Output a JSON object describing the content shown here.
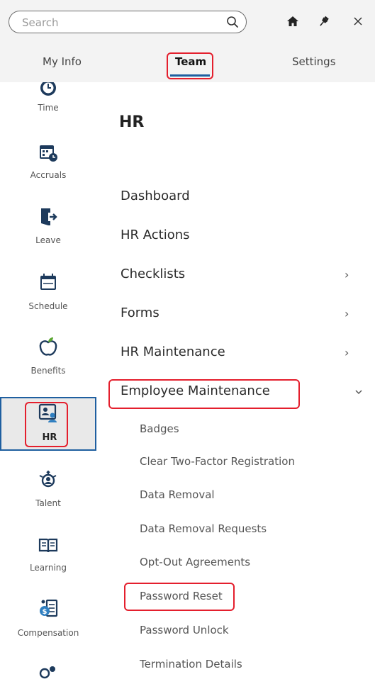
{
  "search": {
    "placeholder": "Search"
  },
  "header_icons": [
    "search-icon",
    "home-icon",
    "pin-icon",
    "close-icon"
  ],
  "tabs": [
    {
      "label": "My Info"
    },
    {
      "label": "Team",
      "active": true
    },
    {
      "label": "Settings"
    }
  ],
  "nav": [
    {
      "label": "Time",
      "icon": "clock-icon"
    },
    {
      "label": "Accruals",
      "icon": "calendar-clock-icon"
    },
    {
      "label": "Leave",
      "icon": "exit-door-icon"
    },
    {
      "label": "Schedule",
      "icon": "calendar-icon"
    },
    {
      "label": "Benefits",
      "icon": "apple-icon"
    },
    {
      "label": "HR",
      "icon": "id-badge-icon",
      "active": true
    },
    {
      "label": "Talent",
      "icon": "talent-person-icon"
    },
    {
      "label": "Learning",
      "icon": "book-icon"
    },
    {
      "label": "Compensation",
      "icon": "money-document-icon"
    }
  ],
  "section": {
    "title": "HR"
  },
  "menu": [
    {
      "label": "Dashboard",
      "has_children": false
    },
    {
      "label": "HR Actions",
      "has_children": false
    },
    {
      "label": "Checklists",
      "has_children": true
    },
    {
      "label": "Forms",
      "has_children": true
    },
    {
      "label": "HR Maintenance",
      "has_children": true
    },
    {
      "label": "Employee Maintenance",
      "has_children": true,
      "expanded": true
    }
  ],
  "submenu": [
    {
      "label": "Badges"
    },
    {
      "label": "Clear Two-Factor Registration"
    },
    {
      "label": "Data Removal"
    },
    {
      "label": "Data Removal Requests"
    },
    {
      "label": "Opt-Out Agreements"
    },
    {
      "label": "Password Reset"
    },
    {
      "label": "Password Unlock"
    },
    {
      "label": "Termination Details"
    }
  ],
  "colors": {
    "accent": "#1f5fa0",
    "highlight": "#e41f2d",
    "icon_dark": "#1d3a5c",
    "bar_bg": "#f3f3f3"
  }
}
